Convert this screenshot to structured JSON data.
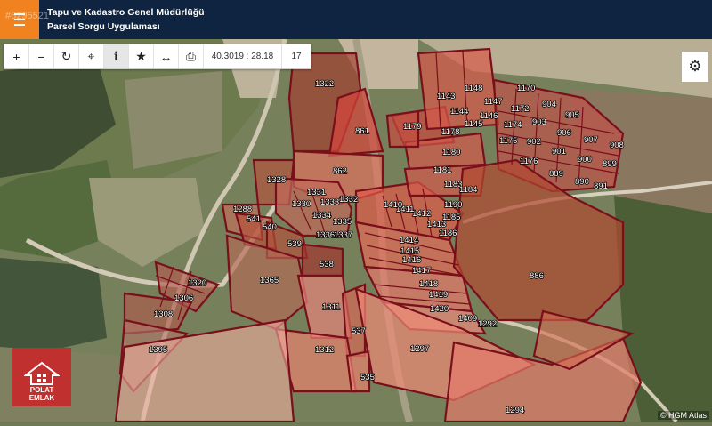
{
  "watermark_top": "#6295521",
  "header": {
    "title_line1": "Tapu ve Kadastro Genel Müdürlüğü",
    "title_line2": "Parsel Sorgu Uygulaması"
  },
  "toolbar": {
    "coordinate": "40.3019 : 28.18",
    "zoom": "17"
  },
  "logo": {
    "line1": "POLAT",
    "line2": "EMLAK"
  },
  "attribution": "© HGM Atlas",
  "colors": {
    "header": "#0f2440",
    "accent": "#f0831f",
    "parcel_border": "#7a0f1c",
    "parcel_fill": "#e8836f"
  },
  "parcels": [
    "1322",
    "861",
    "862",
    "1328",
    "1331",
    "1332",
    "1330",
    "1333",
    "1334",
    "1335",
    "1336",
    "1337",
    "1288",
    "541",
    "540",
    "539",
    "538",
    "1365",
    "1320",
    "1306",
    "1308",
    "1395",
    "1311",
    "537",
    "1312",
    "535",
    "1297",
    "1294",
    "1292",
    "1409",
    "1420",
    "1419",
    "1418",
    "1417",
    "1416",
    "1415",
    "1414",
    "1413",
    "1412",
    "1411",
    "1410",
    "1186",
    "1185",
    "1190",
    "1183",
    "1184",
    "1181",
    "1180",
    "1178",
    "1179",
    "1143",
    "1144",
    "1145",
    "1146",
    "1147",
    "1148",
    "1170",
    "1172",
    "1174",
    "1175",
    "1176",
    "904",
    "905",
    "903",
    "906",
    "907",
    "908",
    "902",
    "901",
    "900",
    "899",
    "889",
    "890",
    "891",
    "886"
  ]
}
